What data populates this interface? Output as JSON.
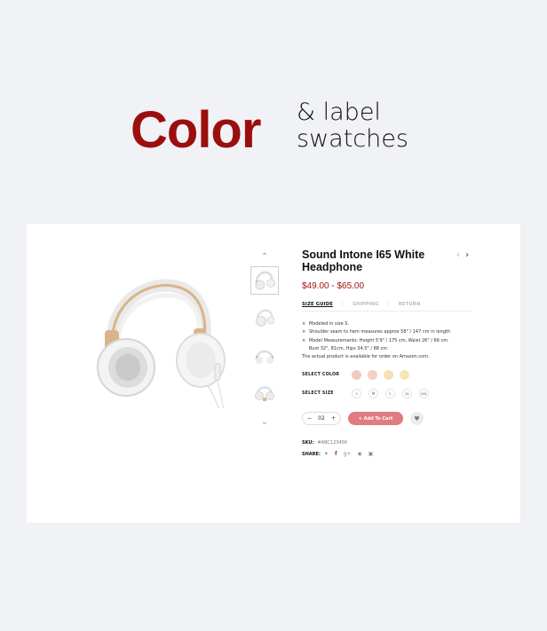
{
  "hero": {
    "title": "Color",
    "subtitle_line1": "& label",
    "subtitle_line2": "swatches"
  },
  "colors": {
    "title": "#9b0e0e",
    "price": "#a01515",
    "add_to_cart_bg": "#e07b80"
  },
  "thumbnails": {
    "up_icon": "chevron-up-icon",
    "down_icon": "chevron-down-icon",
    "count": 4
  },
  "product": {
    "title": "Sound Intone I65 White Headphone",
    "prev_icon": "chevron-left-icon",
    "next_icon": "chevron-right-icon",
    "price": "$49.00 - $65.00",
    "tabs": [
      {
        "label": "SIZE GUIDE",
        "active": true
      },
      {
        "label": "SHIPPING",
        "active": false
      },
      {
        "label": "RETURN",
        "active": false
      }
    ],
    "bullets": [
      "Modeled in size S.",
      "Shoulder seam to hem measures approx 58\" / 147 cm in length",
      "Model Measurements: Height 5'9\" / 175 cm, Waist 26\" / 66 cm.",
      "Bust 32\", 81cm, Hips 34.5\" / 88 cm",
      "The actual product is available for order on Amazon.com."
    ],
    "select_color_label": "SELECT COLOR",
    "color_swatches": [
      "#f2c8c3",
      "#f5cfc0",
      "#f7e0b6",
      "#f4e6b2"
    ],
    "select_size_label": "SELECT SIZE",
    "sizes": [
      "s",
      "M",
      "L",
      "xL",
      "xxL"
    ],
    "quantity": {
      "minus": "−",
      "value": "02",
      "plus": "+"
    },
    "add_to_cart": "+ Add To Cart",
    "wishlist_icon": "heart-icon",
    "sku_label": "SKU:",
    "sku_value": "#ABC123456",
    "share_label": "SHARE:",
    "share_icons": [
      "twitter-icon",
      "facebook-icon",
      "google-plus-icon",
      "pinterest-icon",
      "instagram-icon"
    ]
  }
}
